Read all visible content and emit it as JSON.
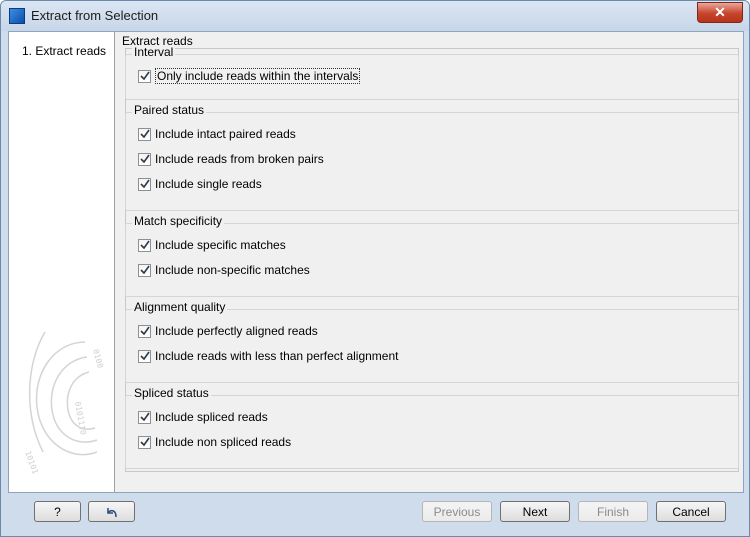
{
  "window": {
    "title": "Extract from Selection",
    "close_glyph": "✕"
  },
  "sidebar": {
    "steps": [
      {
        "label": "1.  Extract reads"
      }
    ]
  },
  "content": {
    "title": "Extract reads",
    "groups": [
      {
        "label": "Interval",
        "options": [
          {
            "label": "Only include reads within the intervals",
            "checked": true
          }
        ]
      },
      {
        "label": "Paired status",
        "options": [
          {
            "label": "Include intact paired reads",
            "checked": true
          },
          {
            "label": "Include reads from broken pairs",
            "checked": true
          },
          {
            "label": "Include single reads",
            "checked": true
          }
        ]
      },
      {
        "label": "Match specificity",
        "options": [
          {
            "label": "Include specific matches",
            "checked": true
          },
          {
            "label": "Include non-specific matches",
            "checked": true
          }
        ]
      },
      {
        "label": "Alignment quality",
        "options": [
          {
            "label": "Include perfectly aligned reads",
            "checked": true
          },
          {
            "label": "Include reads with less than perfect alignment",
            "checked": true
          }
        ]
      },
      {
        "label": "Spliced status",
        "options": [
          {
            "label": "Include spliced reads",
            "checked": true
          },
          {
            "label": "Include non spliced reads",
            "checked": true
          }
        ]
      }
    ]
  },
  "buttons": {
    "help": "?",
    "reset_icon": "undo-arrow-icon",
    "previous": "Previous",
    "next": "Next",
    "finish": "Finish",
    "cancel": "Cancel"
  }
}
